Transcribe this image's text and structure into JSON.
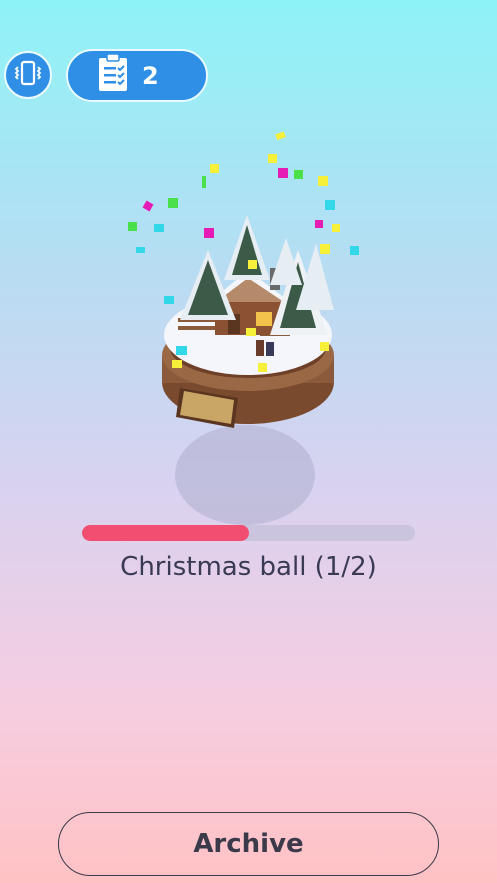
{
  "top_bar": {
    "vibration_icon": "phone-vibrate-icon",
    "tasks_icon": "clipboard-checklist-icon",
    "tasks_count": "2"
  },
  "collectible": {
    "progress_fraction": 0.5,
    "label": "Christmas ball (1/2)"
  },
  "archive_button": {
    "label": "Archive"
  },
  "colors": {
    "accent_blue": "#2f8fe6",
    "progress_fill": "#f24e72",
    "progress_track": "#cbc4df"
  }
}
